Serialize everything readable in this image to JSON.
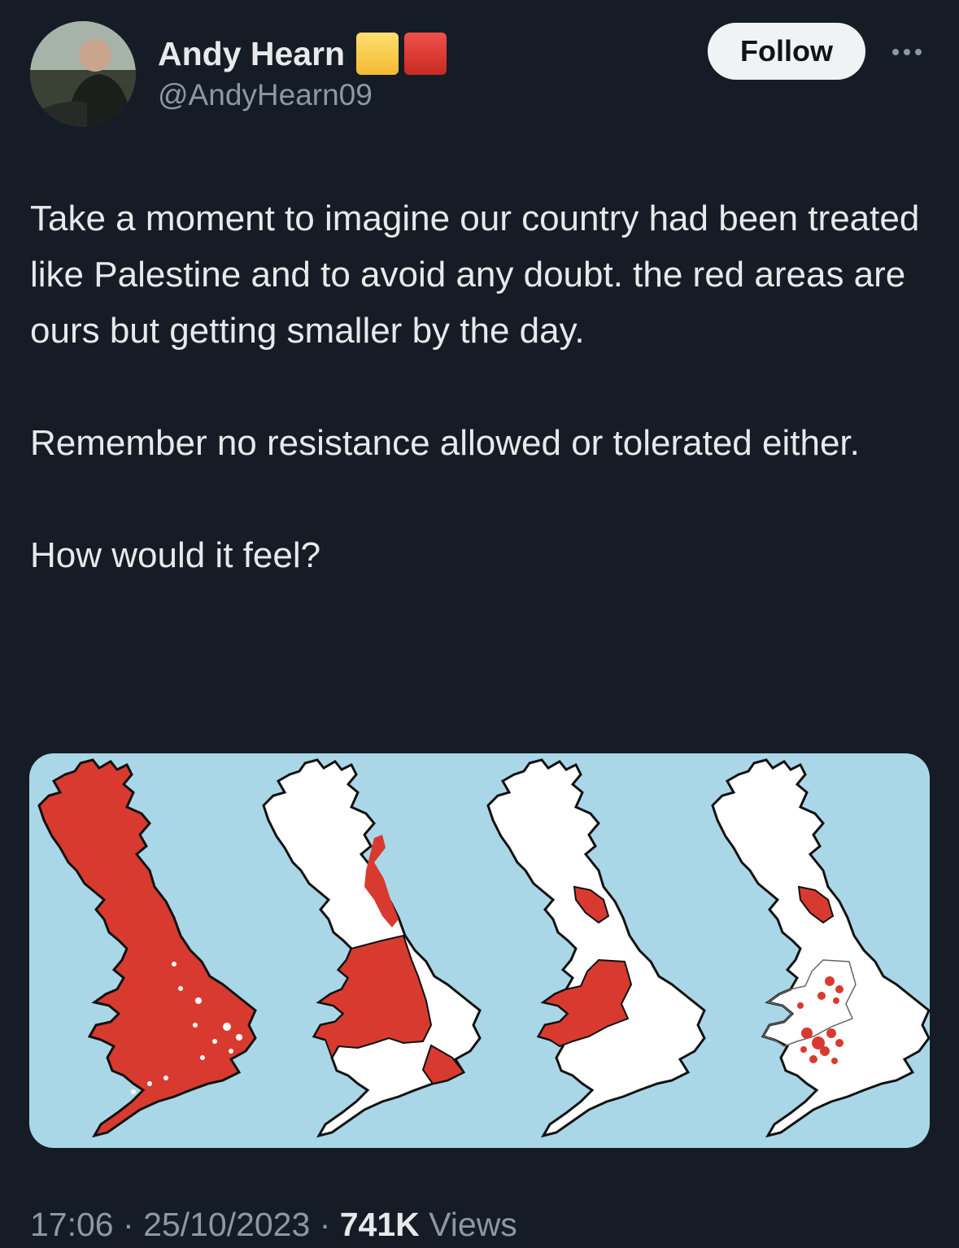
{
  "author": {
    "display_name": "Andy Hearn",
    "handle": "@AndyHearn09",
    "flag_emojis": [
      "yellow-square",
      "red-square"
    ]
  },
  "actions": {
    "follow_label": "Follow"
  },
  "tweet": {
    "paragraphs": [
      "Take a moment to imagine our country had been treated like Palestine and to avoid any doubt. the red areas are ours but getting smaller by the day.",
      "Remember no resistance allowed  or tolerated either.",
      "How would it feel?"
    ]
  },
  "media": {
    "description_maps": 4,
    "colors": {
      "ocean": "#a9d7e7",
      "land": "#ffffff",
      "red": "#d93a2f"
    }
  },
  "meta": {
    "time": "17:06",
    "date": "25/10/2023",
    "sep": "·",
    "views_count": "741K",
    "views_label": "Views"
  }
}
